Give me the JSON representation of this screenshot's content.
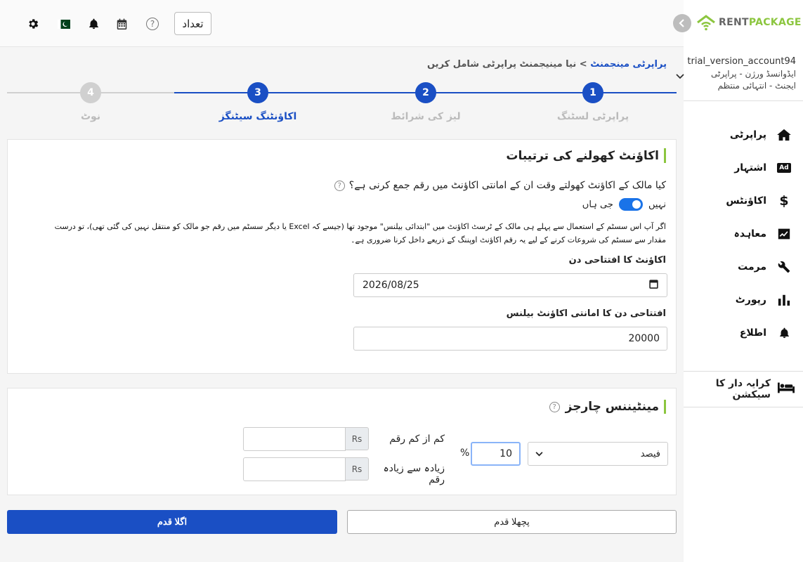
{
  "topbar": {
    "count_button": "تعداد",
    "icons": [
      "gear-icon",
      "pakistan-flag-icon",
      "bell-icon",
      "calendar-icon",
      "help-icon"
    ]
  },
  "sidebar": {
    "logo_text_1": "RENT",
    "logo_text_2": "PACKAGE",
    "account_name": "trial_version_account94",
    "account_line_2": "ایڈوانسڈ ورژن - پراپرٹی",
    "account_line_3": "ایجنٹ - انتہائی منتظم",
    "items": [
      {
        "label": "پراپرٹی",
        "icon": "home-icon"
      },
      {
        "label": "اشتہار",
        "icon": "ad-icon"
      },
      {
        "label": "اکاؤنٹس",
        "icon": "dollar-icon"
      },
      {
        "label": "معاہدہ",
        "icon": "contract-icon"
      },
      {
        "label": "مرمت",
        "icon": "wrench-icon"
      },
      {
        "label": "رپورٹ",
        "icon": "chart-icon"
      },
      {
        "label": "اطلاع",
        "icon": "bell-icon"
      }
    ],
    "tenant_section": "کرایہ دار کا سیکشن"
  },
  "breadcrumb": {
    "link": "پراپرٹی مینجمنٹ",
    "separator": ">",
    "current": "نیا مینیجمنٹ پراپرٹی شامل کریں"
  },
  "stepper": {
    "steps": [
      {
        "number": "1",
        "label": "پراپرٹی لسٹنگ",
        "state": "done"
      },
      {
        "number": "2",
        "label": "لیز کی شرائط",
        "state": "done"
      },
      {
        "number": "3",
        "label": "اکاؤنٹنگ سیٹنگز",
        "state": "active"
      },
      {
        "number": "4",
        "label": "نوٹ",
        "state": "pending"
      }
    ],
    "colors": {
      "active": "#1a4fc4",
      "pending": "#d0d0d0"
    }
  },
  "account_settings": {
    "title": "اکاؤنٹ کھولنے کی ترتیبات",
    "question": "کیا مالک کے اکاؤنٹ کھولتے وقت ان کے امانتی اکاؤنٹ میں رقم جمع کرنی ہے؟",
    "toggle_no": "نہیں",
    "toggle_yes": "جی ہاں",
    "toggle_on": true,
    "info_line_1": "اگر آپ اس سسٹم کے استعمال سے پہلے ہی مالک کے ٹرسٹ اکاؤنٹ میں \"ابتدائی بیلنس\" موجود تھا (جیسے کہ Excel یا دیگر سسٹم میں رقم جو مالک کو منتقل نہیں کی گئی تھی)، تو درست",
    "info_line_2": "مقدار سے سسٹم کی شروعات کرنے کے لیے یہ رقم اکاؤنٹ اوپننگ کے ذریعے داخل کرنا ضروری ہے۔",
    "opening_date_label": "اکاؤنٹ کا افتتاحی دن",
    "opening_date_value": "2026/08/25",
    "opening_balance_label": "افتتاحی دن کا امانتی اکاؤنٹ بیلنس",
    "opening_balance_value": "20000"
  },
  "maintenance": {
    "title": "مینٹیننس چارجز",
    "type_select": "فیصد",
    "percent_value": "10",
    "percent_sign": "%",
    "min_label": "کم از کم رقم",
    "max_label": "زیادہ سے زیادہ رقم",
    "currency": "Rs",
    "min_value": "",
    "max_value": ""
  },
  "buttons": {
    "next": "اگلا قدم",
    "previous": "پچھلا قدم"
  }
}
